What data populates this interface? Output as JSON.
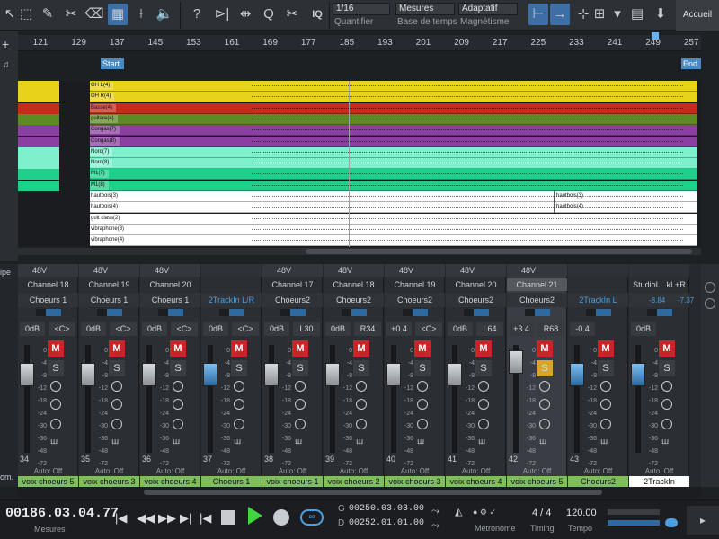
{
  "toolbar": {
    "quantize_value": "1/16",
    "quantize_label": "Quantifier",
    "timebase_value": "Mesures",
    "timebase_label": "Base de temps",
    "snap_value": "Adaptatif",
    "snap_label": "Magnétisme",
    "q_button": "Q",
    "iq_button": "IQ",
    "home_label": "Accueil"
  },
  "ruler": {
    "bars": [
      "121",
      "129",
      "137",
      "145",
      "153",
      "161",
      "169",
      "177",
      "185",
      "193",
      "201",
      "209",
      "217",
      "225",
      "233",
      "241",
      "249",
      "257"
    ]
  },
  "markers": {
    "start": "Start",
    "end": "End"
  },
  "tracks": [
    {
      "name": "OH L(4)",
      "color": "#e8d21a"
    },
    {
      "name": "OH R(4)",
      "color": "#e8d21a"
    },
    {
      "name": "Basse(4)",
      "color": "#c82a1c"
    },
    {
      "name": "guitare(4)",
      "color": "#5d8a22"
    },
    {
      "name": "Congas(7)",
      "color": "#8b3fa0"
    },
    {
      "name": "Congas(8)",
      "color": "#8b3fa0"
    },
    {
      "name": "Nord(7)",
      "color": "#7ff0cc"
    },
    {
      "name": "Nord(8)",
      "color": "#7ff0cc"
    },
    {
      "name": "M1(7)",
      "color": "#1fcf8a"
    },
    {
      "name": "M1(8)",
      "color": "#1fcf8a"
    },
    {
      "name": "hautbois(3)",
      "color": "#ffffff",
      "extra": "hautbois(3)"
    },
    {
      "name": "hautbois(4)",
      "color": "#ffffff",
      "extra": "hautbois(4)"
    },
    {
      "name": "guit class(2)",
      "color": "#ffffff"
    },
    {
      "name": "vibraphone(3)",
      "color": "#ffffff"
    },
    {
      "name": "vibraphone(4)",
      "color": "#ffffff"
    }
  ],
  "mixer": {
    "strips": [
      {
        "phantom": "48V",
        "channel": "Channel 18",
        "group": "Choeurs 1",
        "vol": "0dB",
        "pan": "<C>",
        "num": "34",
        "auto": "Auto: Off",
        "label": "voix choeurs 5"
      },
      {
        "phantom": "48V",
        "channel": "Channel 19",
        "group": "Choeurs 1",
        "vol": "0dB",
        "pan": "<C>",
        "num": "35",
        "auto": "Auto: Off",
        "label": "voix choeurs 3"
      },
      {
        "phantom": "48V",
        "channel": "Channel 20",
        "group": "Choeurs 1",
        "vol": "0dB",
        "pan": "<C>",
        "num": "36",
        "auto": "Auto: Off",
        "label": "voix choeurs 4"
      },
      {
        "phantom": "",
        "channel": "",
        "group": "2TrackIn L/R",
        "vol": "0dB",
        "pan": "<C>",
        "num": "37",
        "auto": "Auto: Off",
        "label": "Choeurs 1"
      },
      {
        "phantom": "48V",
        "channel": "Channel 17",
        "group": "Choeurs2",
        "vol": "0dB",
        "pan": "L30",
        "num": "38",
        "auto": "Auto: Off",
        "label": "voix choeurs 1"
      },
      {
        "phantom": "48V",
        "channel": "Channel 18",
        "group": "Choeurs2",
        "vol": "0dB",
        "pan": "R34",
        "num": "39",
        "auto": "Auto: Off",
        "label": "voix choeurs 2"
      },
      {
        "phantom": "48V",
        "channel": "Channel 19",
        "group": "Choeurs2",
        "vol": "+0.4",
        "pan": "<C>",
        "num": "40",
        "auto": "Auto: Off",
        "label": "voix choeurs 3"
      },
      {
        "phantom": "48V",
        "channel": "Channel 20",
        "group": "Choeurs2",
        "vol": "0dB",
        "pan": "L64",
        "num": "41",
        "auto": "Auto: Off",
        "label": "voix choeurs 4"
      },
      {
        "phantom": "48V",
        "channel": "Channel 21",
        "group": "Choeurs2",
        "vol": "+3.4",
        "pan": "R68",
        "num": "42",
        "auto": "Auto: Off",
        "label": "voix choeurs 5"
      },
      {
        "phantom": "",
        "channel": "",
        "group": "2TrackIn L",
        "vol": "-0.4",
        "pan": "",
        "num": "43",
        "auto": "Auto: Off",
        "label": "Choeurs2"
      },
      {
        "phantom": "",
        "channel": "StudioLi..kL+R",
        "group": "",
        "vol": "0dB",
        "pan": "",
        "num": "",
        "auto": "Auto: Off",
        "label": "2TrackIn"
      }
    ],
    "meter_readout_a": "-8.84",
    "meter_readout_b": "-7.37",
    "scale": [
      "0",
      "-4",
      "-8",
      "-12",
      "-18",
      "-24",
      "-30",
      "-36",
      "-48",
      "-72"
    ],
    "left_labels": {
      "top": "ipe",
      "bottom": "om."
    }
  },
  "transport": {
    "position": "00186.03.04.77",
    "position_label": "Mesures",
    "loop_start": "00250.03.03.00",
    "loop_end": "00252.01.01.00",
    "metronome_label": "Métronome",
    "timing_value": "4 / 4",
    "timing_label": "Timing",
    "tempo_value": "120.00",
    "tempo_label": "Tempo"
  }
}
